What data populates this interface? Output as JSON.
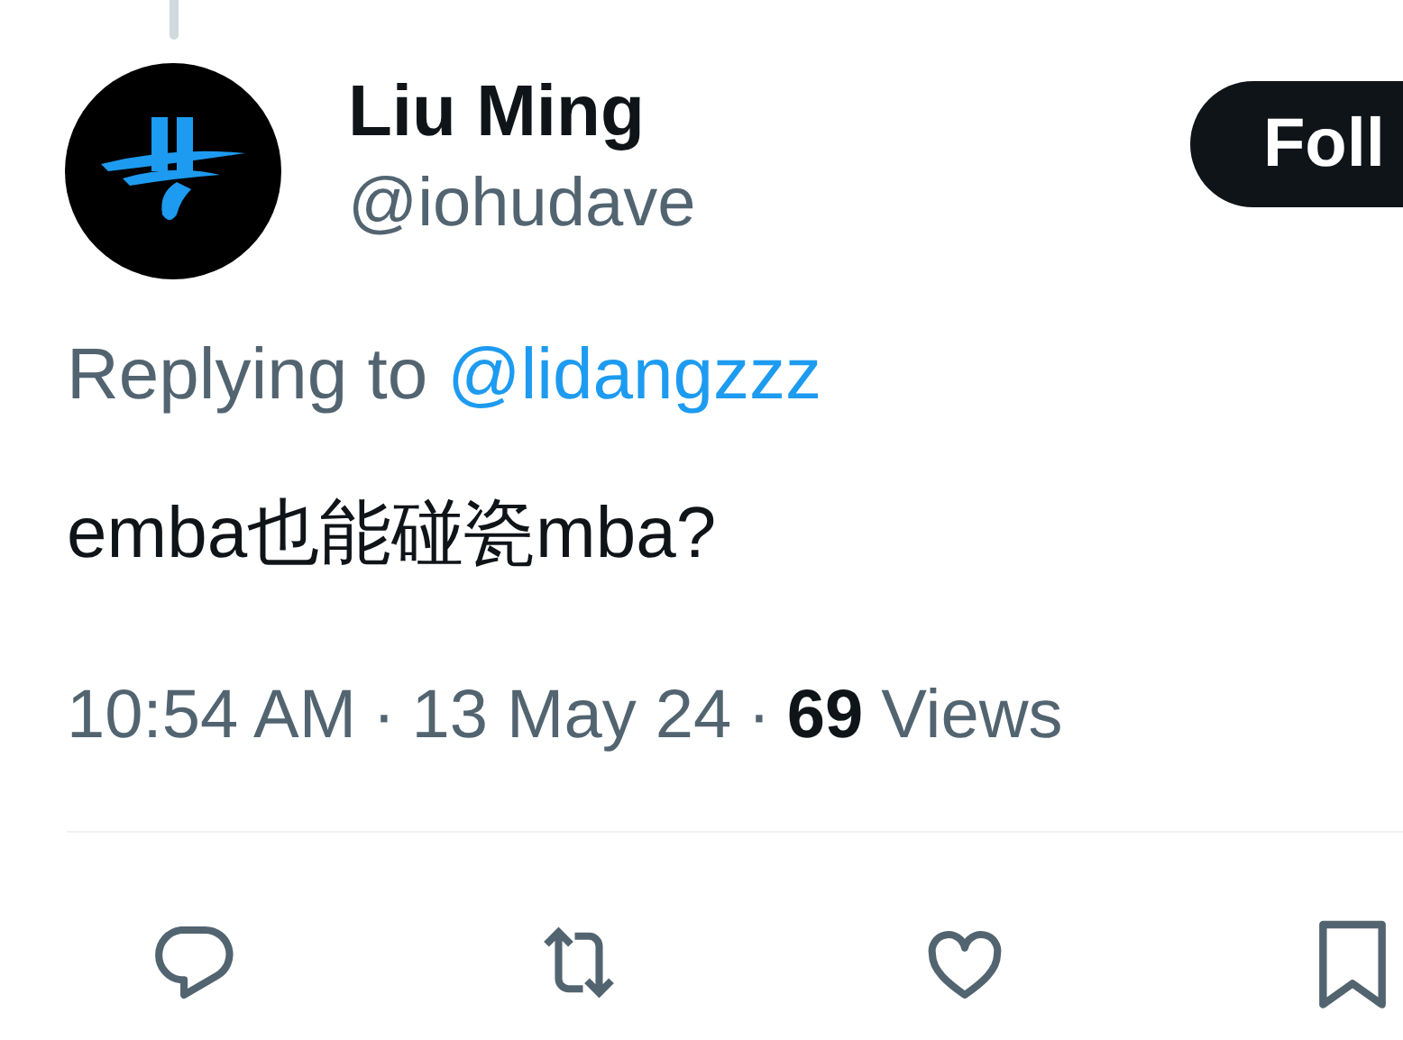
{
  "author": {
    "name": "Liu Ming",
    "handle": "@iohudave"
  },
  "follow_button": {
    "label": "Foll"
  },
  "reply_context": {
    "prefix": "Replying to",
    "mention": "@lidangzzz"
  },
  "tweet_text": "emba也能碰瓷mba?",
  "meta": {
    "time": "10:54 AM",
    "separator_1": "·",
    "date": "13 May 24",
    "separator_2": "·",
    "views_count": "69",
    "views_label": "Views"
  }
}
